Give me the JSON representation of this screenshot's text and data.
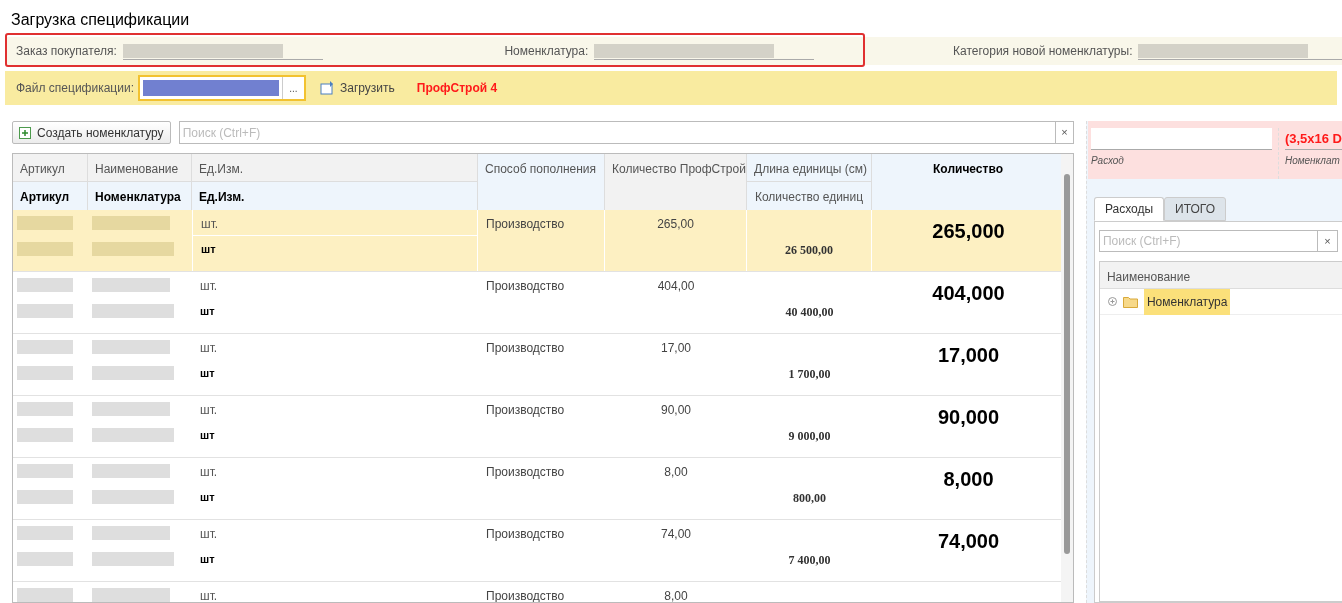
{
  "window": {
    "title": "Загрузка спецификации"
  },
  "header_fields": [
    {
      "label": "Заказ покупателя:",
      "highlighted": true
    },
    {
      "label": "Номенклатура:",
      "highlighted": true
    },
    {
      "label": "Категория новой номенклатуры:",
      "highlighted": false
    }
  ],
  "file_bar": {
    "label": "Файл спецификации:",
    "select_button": "...",
    "load_button": "Загрузить",
    "status": "ПрофСтрой 4"
  },
  "toolbar": {
    "create_button": "Создать номенклатуру",
    "search": {
      "placeholder": "Поиск (Ctrl+F)"
    },
    "clear_button": "×"
  },
  "table": {
    "columns": [
      {
        "top": "Артикул",
        "bottom": "Артикул"
      },
      {
        "top": "Наименование",
        "bottom": "Номенклатура"
      },
      {
        "top": "Ед.Изм.",
        "bottom": "Ед.Изм."
      },
      {
        "top": "Способ пополнения"
      },
      {
        "top": "Количество ПрофСтрой"
      },
      {
        "top": "Длина единицы (см)",
        "bottom": "Количество единиц"
      },
      {
        "top": "Количество"
      }
    ],
    "rows": [
      {
        "selected": true,
        "unit": "шт.",
        "unit2": "шт",
        "method": "Производство",
        "qty_ps": "265,00",
        "units_count": "26 500,00",
        "quantity": "265,000"
      },
      {
        "selected": false,
        "unit": "шт.",
        "unit2": "шт",
        "method": "Производство",
        "qty_ps": "404,00",
        "units_count": "40 400,00",
        "quantity": "404,000"
      },
      {
        "selected": false,
        "unit": "шт.",
        "unit2": "шт",
        "method": "Производство",
        "qty_ps": "17,00",
        "units_count": "1 700,00",
        "quantity": "17,000"
      },
      {
        "selected": false,
        "unit": "шт.",
        "unit2": "шт",
        "method": "Производство",
        "qty_ps": "90,00",
        "units_count": "9 000,00",
        "quantity": "90,000"
      },
      {
        "selected": false,
        "unit": "шт.",
        "unit2": "шт",
        "method": "Производство",
        "qty_ps": "8,00",
        "units_count": "800,00",
        "quantity": "8,000"
      },
      {
        "selected": false,
        "unit": "шт.",
        "unit2": "шт",
        "method": "Производство",
        "qty_ps": "74,00",
        "units_count": "7 400,00",
        "quantity": "74,000"
      },
      {
        "selected": false,
        "unit": "шт.",
        "method": "Производство",
        "qty_ps": "8,00"
      }
    ]
  },
  "side_panel": {
    "fields": [
      {
        "caption": "Расход"
      },
      {
        "value": "(3,5х16 D",
        "caption": "Номенклат"
      }
    ],
    "tabs": [
      {
        "label": "Расходы",
        "selected": true
      },
      {
        "label": "ИТОГО",
        "selected": false
      }
    ],
    "search": {
      "placeholder": "Поиск (Ctrl+F)"
    },
    "clear_button": "×",
    "tree": {
      "column": "Наименование",
      "items": [
        {
          "label": "Номенклатура",
          "selected": true
        }
      ]
    }
  }
}
